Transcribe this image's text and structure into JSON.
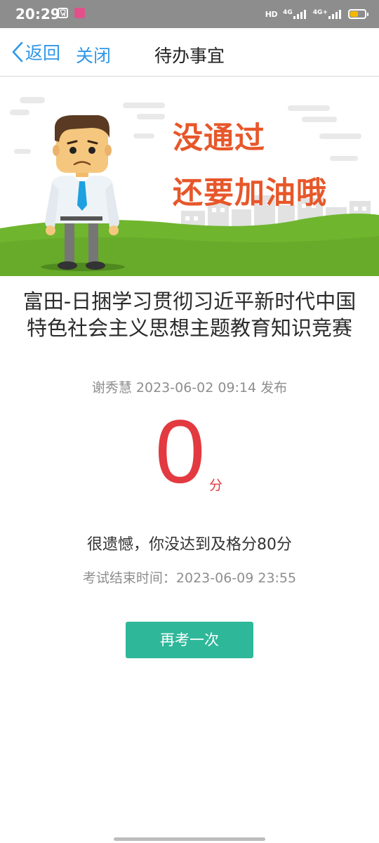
{
  "status_bar": {
    "time": "20:29",
    "hd_label": "HD",
    "network_1": "4G",
    "network_2": "4G+",
    "battery_level": 0.55,
    "battery_color": "#f5b800",
    "app_icons": [
      "tooth-app-icon",
      "pink-app-icon"
    ]
  },
  "nav": {
    "back_label": "返回",
    "close_label": "关闭",
    "title": "待办事宜",
    "accent_color": "#2f97e7"
  },
  "banner": {
    "line1": "没通过",
    "line2": "还要加油哦",
    "text_color": "#e7572a",
    "grass_color": "#6fb52e"
  },
  "result": {
    "contest_title": "富田-日捆学习贯彻习近平新时代中国特色社会主义思想主题教育知识竞赛",
    "publisher": "谢秀慧",
    "publish_time": "2023-06-02 09:14",
    "publish_suffix": "发布",
    "score": "0",
    "score_unit": "分",
    "score_color": "#e23a40",
    "fail_message": "很遗憾，你没达到及格分80分",
    "passing_score": 80,
    "end_time_label": "考试结束时间：2023-06-09 23:55"
  },
  "actions": {
    "retry_label": "再考一次",
    "retry_color": "#2fb79a"
  }
}
